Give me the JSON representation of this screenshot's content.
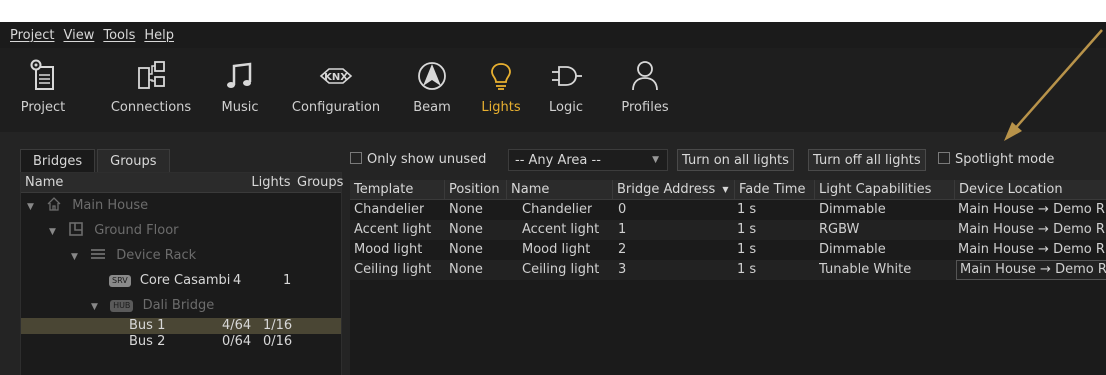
{
  "menu": {
    "items": [
      "Project",
      "View",
      "Tools",
      "Help"
    ]
  },
  "toolbar": {
    "items": [
      {
        "label": "Project"
      },
      {
        "label": "Connections"
      },
      {
        "label": "Music"
      },
      {
        "label": "Configuration"
      },
      {
        "label": "Beam"
      },
      {
        "label": "Lights"
      },
      {
        "label": "Logic"
      },
      {
        "label": "Profiles"
      }
    ],
    "active": "Lights",
    "knx_text": "KNX",
    "accent_color": "#e8b030"
  },
  "left_panel": {
    "tabs": [
      "Bridges",
      "Groups"
    ],
    "active_tab": "Bridges",
    "columns": [
      "Name",
      "Lights",
      "Groups"
    ],
    "rows": [
      {
        "name": "Main House",
        "lights": "",
        "groups": ""
      },
      {
        "name": "Ground Floor",
        "lights": "",
        "groups": ""
      },
      {
        "name": "Device Rack",
        "lights": "",
        "groups": ""
      },
      {
        "badge": "SRV",
        "name": "Core Casambi",
        "lights": "4",
        "groups": "1"
      },
      {
        "badge": "HUB",
        "name": "Dali Bridge",
        "lights": "",
        "groups": ""
      },
      {
        "name": "Bus 1",
        "lights": "4/64",
        "groups": "1/16"
      },
      {
        "name": "Bus 2",
        "lights": "0/64",
        "groups": "0/16"
      }
    ]
  },
  "controls": {
    "only_unused": "Only show unused",
    "area": "-- Any Area --",
    "turn_on": "Turn on all lights",
    "turn_off": "Turn off all lights",
    "spotlight": "Spotlight mode"
  },
  "table": {
    "columns": [
      "Template",
      "Position",
      "Name",
      "Bridge Address",
      "Fade Time",
      "Light Capabilities",
      "Device Location"
    ],
    "sort_column": "Bridge Address",
    "rows": [
      [
        "Chandelier",
        "None",
        "Chandelier",
        "0",
        "1 s",
        "Dimmable",
        "Main House → Demo R"
      ],
      [
        "Accent light",
        "None",
        "Accent light",
        "1",
        "1 s",
        "RGBW",
        "Main House → Demo R"
      ],
      [
        "Mood light",
        "None",
        "Mood light",
        "2",
        "1 s",
        "Dimmable",
        "Main House → Demo R"
      ],
      [
        "Ceiling light",
        "None",
        "Ceiling light",
        "3",
        "1 s",
        "Tunable White",
        "Main House → Demo R"
      ]
    ]
  },
  "annotation": {
    "arrow_color": "#b8934a"
  }
}
